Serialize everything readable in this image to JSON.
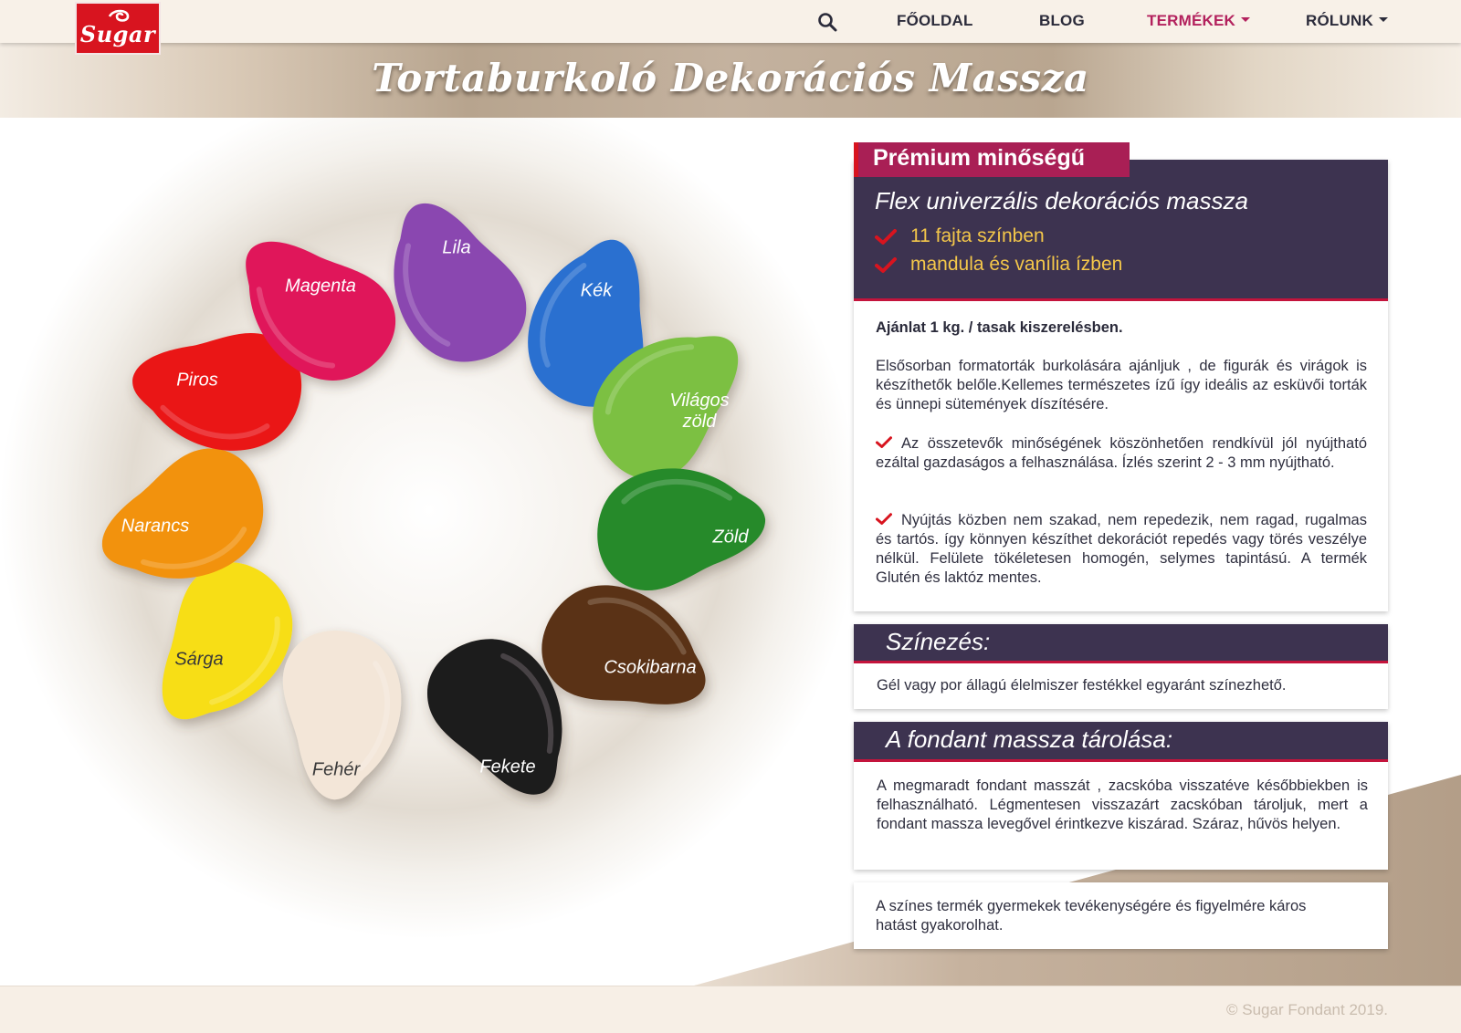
{
  "brand": {
    "logo_text": "Sugar",
    "logo_color": "#d8141f"
  },
  "nav": {
    "search_icon": "search-icon",
    "items": [
      {
        "label": "FŐOLDAL",
        "active": false,
        "dropdown": false
      },
      {
        "label": "BLOG",
        "active": false,
        "dropdown": false
      },
      {
        "label": "TERMÉKEK",
        "active": true,
        "dropdown": true
      },
      {
        "label": "RÓLUNK",
        "active": false,
        "dropdown": true
      }
    ]
  },
  "hero": {
    "title": "Tortaburkoló Dekorációs Massza"
  },
  "colors": {
    "accent": "#b3215d",
    "panel_dark": "#3d3350",
    "rule_red": "#c4143c",
    "feature_yellow": "#f4c74a",
    "check_red": "#d8141f"
  },
  "blobs": [
    {
      "label": "Lila",
      "color": "#8a47b0"
    },
    {
      "label": "Kék",
      "color": "#2a6fd0"
    },
    {
      "label": "Világos zöld",
      "color": "#7cc043"
    },
    {
      "label": "Zöld",
      "color": "#278a2b"
    },
    {
      "label": "Csokibarna",
      "color": "#5a3214"
    },
    {
      "label": "Fekete",
      "color": "#1e1a1c"
    },
    {
      "label": "Fehér",
      "color": "#f3e6d8"
    },
    {
      "label": "Sárga",
      "color": "#f7de19"
    },
    {
      "label": "Narancs",
      "color": "#f2920b"
    },
    {
      "label": "Piros",
      "color": "#ea1418"
    },
    {
      "label": "Magenta",
      "color": "#e0175a"
    }
  ],
  "product": {
    "premium_tag": "Prémium minőségű",
    "subtitle": "Flex univerzális dekorációs massza",
    "features": [
      "11 fajta színben",
      "mandula és vanília ízben"
    ],
    "offer": "Ajánlat 1 kg. / tasak kiszerelésben.",
    "intro": "Elsősorban formatorták burkolására ajánljuk , de figurák és virágok is készíthetők belőle.Kellemes természetes ízű így ideális az esküvői torták és ünnepi sütemények díszítésére.",
    "point1": "Az összetevők minőségének köszönhetően rendkívül  jól nyújtható ezáltal gazdaságos a felhasználása. Ízlés szerint 2 - 3 mm nyújtható.",
    "point2": "Nyújtás közben nem szakad, nem repedezik, nem ragad, rugalmas és tartós. így könnyen készíthet dekorációt repedés vagy törés veszélye nélkül. Felülete tökéletesen homogén, selymes tapintású. A termék Glutén és laktóz mentes."
  },
  "coloring": {
    "title": "Színezés:",
    "text": "Gél vagy por állagú élelmiszer festékkel egyaránt színezhető."
  },
  "storage": {
    "title": "A fondant massza tárolása:",
    "text": "A megmaradt fondant masszát , zacskóba visszatéve későbbiekben  is felhasználható.  Légmentesen visszazárt zacskóban tároljuk, mert a fondant massza levegővel érintkezve kiszárad. Száraz, hűvös helyen."
  },
  "warning": {
    "text": "A színes termék gyermekek tevékenységére és figyelmére káros hatást gyakorolhat."
  },
  "footer": {
    "copyright": "© Sugar Fondant 2019."
  }
}
